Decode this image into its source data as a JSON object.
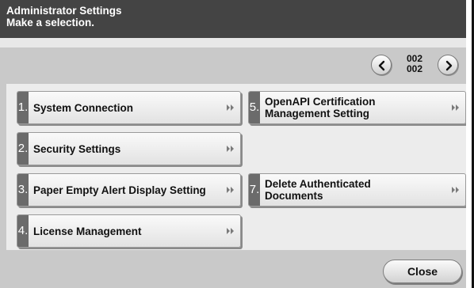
{
  "header": {
    "title": "Administrator Settings",
    "prompt": "Make a selection."
  },
  "pager": {
    "current_page": "002",
    "total_pages": "002",
    "prev_icon": "chevron-left-icon",
    "next_icon": "chevron-right-icon"
  },
  "menu": {
    "items": [
      {
        "number": "1.",
        "label": "System Connection",
        "icon": "double-arrow-right-icon"
      },
      {
        "number": "2.",
        "label": "Security Settings",
        "icon": "double-arrow-right-icon"
      },
      {
        "number": "3.",
        "label": "Paper Empty Alert Display Setting",
        "icon": "double-arrow-right-icon"
      },
      {
        "number": "4.",
        "label": "License Management",
        "icon": "double-arrow-right-icon"
      },
      {
        "number": "5.",
        "label": "OpenAPI Certification Management Setting",
        "icon": "double-arrow-right-icon"
      },
      {
        "number": "7.",
        "label": "Delete Authenticated Documents",
        "icon": "double-arrow-right-icon"
      }
    ]
  },
  "footer": {
    "close_label": "Close"
  },
  "colors": {
    "header_bg": "#444444",
    "screen_bg": "#c9c9c9",
    "panel_bg": "#ececec",
    "number_tab": "#6b6b6b"
  }
}
